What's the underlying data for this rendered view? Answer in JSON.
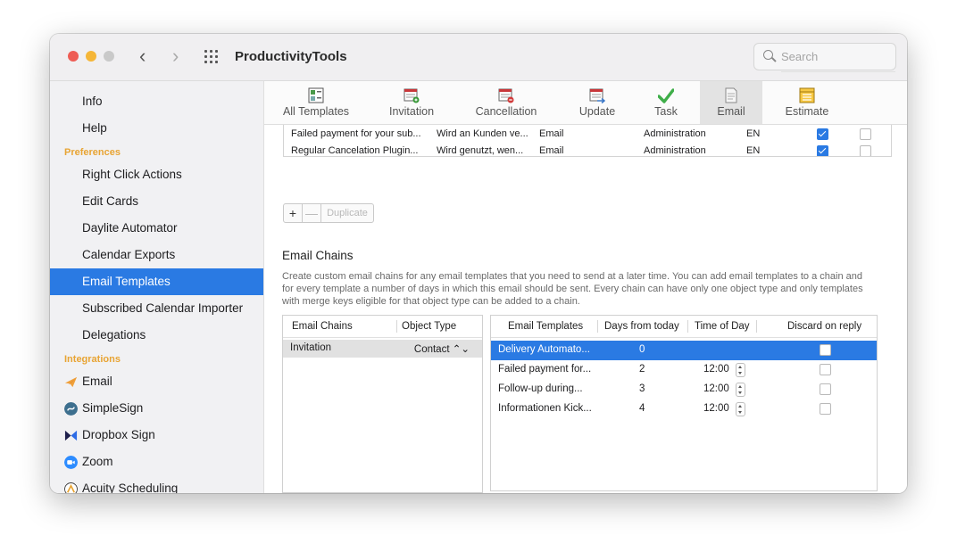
{
  "app": {
    "title": "ProductivityTools",
    "search_placeholder": "Search"
  },
  "sidebar": {
    "items_top": [
      "Info",
      "Help"
    ],
    "preferences_header": "Preferences",
    "preferences": [
      "Right Click Actions",
      "Edit Cards",
      "Daylite Automator",
      "Calendar Exports",
      "Email Templates",
      "Subscribed Calendar Importer",
      "Delegations"
    ],
    "selected": "Email Templates",
    "integrations_header": "Integrations",
    "integrations": [
      "Email",
      "SimpleSign",
      "Dropbox Sign",
      "Zoom",
      "Acuity Scheduling"
    ]
  },
  "toolbar": {
    "tabs": [
      "All Templates",
      "Invitation",
      "Cancellation",
      "Update",
      "Task",
      "Email",
      "Estimate"
    ],
    "selected": "Email"
  },
  "templates_table": {
    "rows": [
      {
        "name": "Failed payment for your sub...",
        "description": "Wird an Kunden ve...",
        "type": "Email",
        "category": "Administration",
        "lang": "EN",
        "checked_a": true,
        "checked_b": false
      },
      {
        "name": "Regular Cancelation Plugin...",
        "description": "Wird genutzt, wen...",
        "type": "Email",
        "category": "Administration",
        "lang": "EN",
        "checked_a": true,
        "checked_b": false
      }
    ],
    "buttons": {
      "add": "+",
      "remove": "—",
      "duplicate": "Duplicate"
    }
  },
  "email_chains": {
    "title": "Email Chains",
    "description": "Create custom email chains for any email templates that you need to send at a later time. You can add email templates to a chain and for every template a number of days in which this email should be sent. Every chain can have only one object type and only templates with merge keys eligible for that object type can be added to a chain.",
    "chains_table": {
      "headers": [
        "Email Chains",
        "Object Type"
      ],
      "rows": [
        {
          "name": "Invitation",
          "object_type": "Contact ⌃⌄"
        }
      ]
    },
    "templates_table": {
      "headers": [
        "Email Templates",
        "Days from today",
        "Time of Day",
        "Discard on reply"
      ],
      "rows": [
        {
          "template": "Delivery Automato...",
          "days": "0",
          "time": "",
          "discard": false,
          "selected": true
        },
        {
          "template": "Failed payment for...",
          "days": "2",
          "time": "12:00",
          "discard": false,
          "selected": false
        },
        {
          "template": "Follow-up during...",
          "days": "3",
          "time": "12:00",
          "discard": false,
          "selected": false
        },
        {
          "template": "Informationen Kick...",
          "days": "4",
          "time": "12:00",
          "discard": false,
          "selected": false
        }
      ]
    },
    "buttons": {
      "add": "+",
      "remove": "−"
    }
  },
  "colors": {
    "accent": "#2a7ae3",
    "section_header": "#e8a433"
  }
}
